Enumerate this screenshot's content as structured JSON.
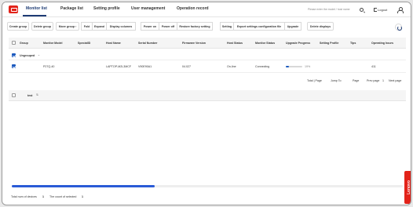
{
  "header": {
    "tabs": [
      {
        "label": "Monitor list",
        "active": true
      },
      {
        "label": "Package list"
      },
      {
        "label": "Setting profile"
      },
      {
        "label": "User management"
      },
      {
        "label": "Operation record"
      }
    ],
    "search_placeholder": "Please enter the model / host name",
    "logout_label": "Logout"
  },
  "toolbar": {
    "create_group": "Create group",
    "delete_group": "Delete group",
    "move_group": "Move group",
    "fold": "Fold",
    "expand": "Expand",
    "display_columns": "Display columns",
    "power_on": "Power on",
    "power_off": "Power off",
    "restore_factory": "Restore factory setting",
    "setting": "Setting",
    "export_settings": "Export settings configuration file",
    "upgrade": "Upgrade",
    "delete_displays": "Delete displays"
  },
  "table": {
    "columns": [
      "Group",
      "Monitor Model",
      "SpecialID",
      "Host Name",
      "Serial Number",
      "Firmware Version",
      "Host Status",
      "Monitor Status",
      "Upgrade Progress",
      "Setting Profile",
      "Tips",
      "Operating hours"
    ],
    "group_label": "Ungrouped",
    "row": {
      "model": "P27Q-40",
      "host_name": "LAPTOP-M2L3MCF",
      "serial_number": "V90E90A1",
      "firmware": "04.027",
      "host_status": "On-line",
      "monitor_status": "Connecting",
      "progress_text": "19%",
      "progress_value": 0.19,
      "operating_hours": "411"
    },
    "pager": {
      "total": "Total | Page",
      "jump_to": "Jump To",
      "page": "Page",
      "prev": "Prev page",
      "page_num": "1",
      "next": "Next page"
    }
  },
  "section2": {
    "label": "test"
  },
  "footer": {
    "total_label": "Total num of devices",
    "total_value": "1",
    "selected_label": "The count of selected",
    "selected_value": "1"
  },
  "brand": {
    "name": "Lenovo",
    "accent": "#e2231a",
    "primary": "#1d3b74"
  }
}
